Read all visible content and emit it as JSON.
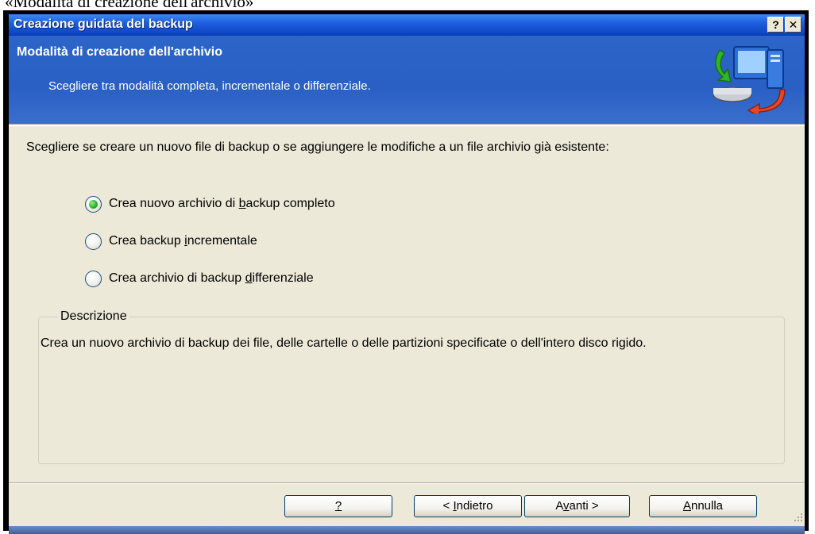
{
  "caption": "«Modalità di creazione dell'archivio»",
  "window": {
    "title": "Creazione guidata del backup",
    "help_label": "?",
    "close_label": "✕"
  },
  "header": {
    "title": "Modalità di creazione dell'archivio",
    "subtitle": "Scegliere tra modalità completa, incrementale o differenziale.",
    "icon": "backup-computer-icon"
  },
  "body": {
    "prompt": "Scegliere se creare un nuovo file di backup o se aggiungere le modifiche a un file archivio già esistente:",
    "options": [
      {
        "pre": "Crea nuovo archivio di ",
        "accel": "b",
        "post": "ackup completo",
        "selected": true
      },
      {
        "pre": "Crea backup ",
        "accel": "i",
        "post": "ncrementale",
        "selected": false
      },
      {
        "pre": "Crea archivio di backup ",
        "accel": "d",
        "post": "ifferenziale",
        "selected": false
      }
    ],
    "description_label": "Descrizione",
    "description_text": "Crea un nuovo archivio di backup dei file, delle cartelle o delle partizioni specificate o dell'intero disco rigido."
  },
  "buttons": {
    "help": {
      "accel": "?"
    },
    "back": {
      "pre": "< ",
      "accel": "I",
      "post": "ndietro"
    },
    "next": {
      "pre": "A",
      "accel": "v",
      "post": "anti >"
    },
    "cancel": {
      "pre": "",
      "accel": "A",
      "post": "nnulla"
    }
  },
  "colors": {
    "titlebar": "#1d5fe0",
    "header": "#2c64c8",
    "dialog": "#ece9d8",
    "selected_radio": "#2fb52a"
  }
}
